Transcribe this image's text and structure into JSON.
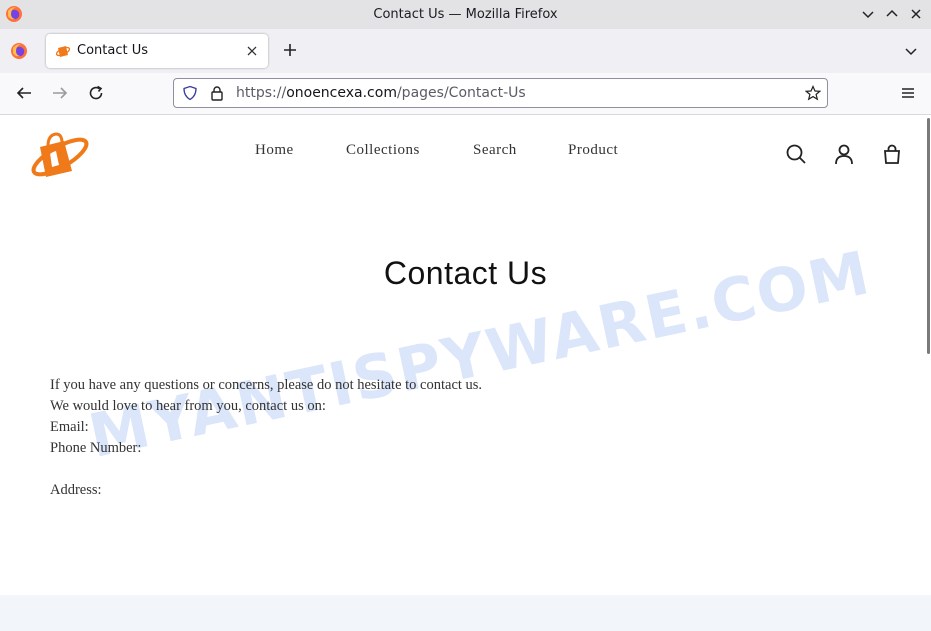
{
  "window": {
    "title": "Contact Us — Mozilla Firefox"
  },
  "tabs": [
    {
      "label": "Contact Us",
      "active": true
    }
  ],
  "urlbar": {
    "scheme": "https://",
    "host": "onoencexa.com",
    "path": "/pages/Contact-Us"
  },
  "site": {
    "brand_color": "#f07a1a",
    "nav": [
      "Home",
      "Collections",
      "Search",
      "Product"
    ],
    "header_icons": [
      "search-icon",
      "account-icon",
      "cart-icon"
    ]
  },
  "page": {
    "heading": "Contact Us",
    "lines": [
      "If you have any questions or concerns, please do not hesitate to contact us.",
      "We would love to hear from you, contact us on:",
      "Email:",
      "Phone Number:",
      "",
      "Address:"
    ]
  },
  "watermark": "MYANTISPYWARE.COM"
}
